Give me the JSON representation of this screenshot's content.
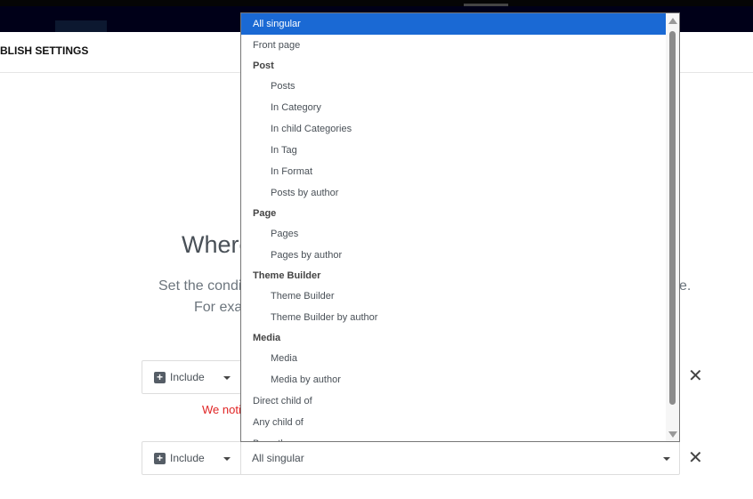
{
  "header": {
    "title": "BLISH SETTINGS"
  },
  "main": {
    "heading": "Where",
    "subtitle_left": "Set the condi",
    "subtitle_right": "e.",
    "subtitle_line2": "For exa",
    "warning": "We noti"
  },
  "rows": [
    {
      "mode": "Include",
      "value": ""
    },
    {
      "mode": "Include",
      "value": "All singular"
    }
  ],
  "dropdown": {
    "options": [
      {
        "label": "All singular",
        "type": "option",
        "selected": true
      },
      {
        "label": "Front page",
        "type": "option"
      },
      {
        "label": "Post",
        "type": "group"
      },
      {
        "label": "Posts",
        "type": "sub"
      },
      {
        "label": "In Category",
        "type": "sub"
      },
      {
        "label": "In child Categories",
        "type": "sub"
      },
      {
        "label": "In Tag",
        "type": "sub"
      },
      {
        "label": "In Format",
        "type": "sub"
      },
      {
        "label": "Posts by author",
        "type": "sub"
      },
      {
        "label": "Page",
        "type": "group"
      },
      {
        "label": "Pages",
        "type": "sub"
      },
      {
        "label": "Pages by author",
        "type": "sub"
      },
      {
        "label": "Theme Builder",
        "type": "group"
      },
      {
        "label": "Theme Builder",
        "type": "sub"
      },
      {
        "label": "Theme Builder by author",
        "type": "sub"
      },
      {
        "label": "Media",
        "type": "group"
      },
      {
        "label": "Media",
        "type": "sub"
      },
      {
        "label": "Media by author",
        "type": "sub"
      },
      {
        "label": "Direct child of",
        "type": "option"
      },
      {
        "label": "Any child of",
        "type": "option"
      },
      {
        "label": "By author",
        "type": "option"
      }
    ]
  },
  "colors": {
    "selected": "#1a69d4",
    "warning": "#e02424"
  }
}
